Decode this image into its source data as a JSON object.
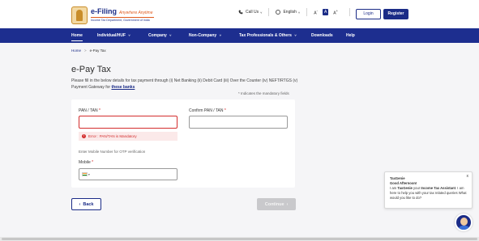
{
  "header": {
    "logo": {
      "title": "e-Filing",
      "tagline": "Anywhere Anytime",
      "department": "Income Tax Department, Government of India"
    },
    "call_us": "Call Us",
    "language": "English",
    "font_sizes": [
      "A",
      "A",
      "A"
    ],
    "font_size_suffix": [
      "-",
      "",
      "+"
    ],
    "login_label": "Login",
    "register_label": "Register"
  },
  "nav": {
    "items": [
      {
        "label": "Home",
        "active": true
      },
      {
        "label": "Individual/HUF",
        "dropdown": true
      },
      {
        "label": "Company",
        "dropdown": true
      },
      {
        "label": "Non-Company",
        "dropdown": true
      },
      {
        "label": "Tax Professionals & Others",
        "dropdown": true
      },
      {
        "label": "Downloads"
      },
      {
        "label": "Help"
      }
    ],
    "caret": "˅"
  },
  "breadcrumb": {
    "home": "Home",
    "separator": ">",
    "current": "e-Pay Tax"
  },
  "page": {
    "title": "e-Pay Tax",
    "description": "Please fill in the below details for tax payment through (i) Net Banking (ii) Debit Card (iii) Over the Counter (iv) NEFT/RTGS (v) Payment Gateway for",
    "banks_link": "these banks",
    "mandatory_note": "* Indicates the mandatory fields"
  },
  "form": {
    "pan_label": "PAN / TAN",
    "pan_value": "",
    "confirm_label": "Confirm PAN / TAN",
    "confirm_value": "",
    "required_marker": "*",
    "error_icon": "!",
    "error_text": "Error : PAN/TAN is Mandatory",
    "otp_note": "Enter Mobile Number for OTP verification",
    "mobile_label": "Mobile",
    "mobile_value": "",
    "country_caret": "▾"
  },
  "actions": {
    "back_label": "Back",
    "back_icon": "‹",
    "continue_label": "Continue",
    "continue_icon": "›"
  },
  "chat": {
    "title": "TaxGenie",
    "greeting": "Good Afternoon!",
    "intro_prefix": "I am",
    "name": "TaxGenie",
    "intro_mid": "your",
    "role": "Income Tax Assistant",
    "intro_suffix": ". I am here to help you with your tax related queries What would you like to do?",
    "close": "x"
  },
  "colors": {
    "brand_blue": "#1d2e8f",
    "error_red": "#d32d2d",
    "error_bg": "#fbe9e9",
    "disabled_gray": "#c9c9cc"
  }
}
